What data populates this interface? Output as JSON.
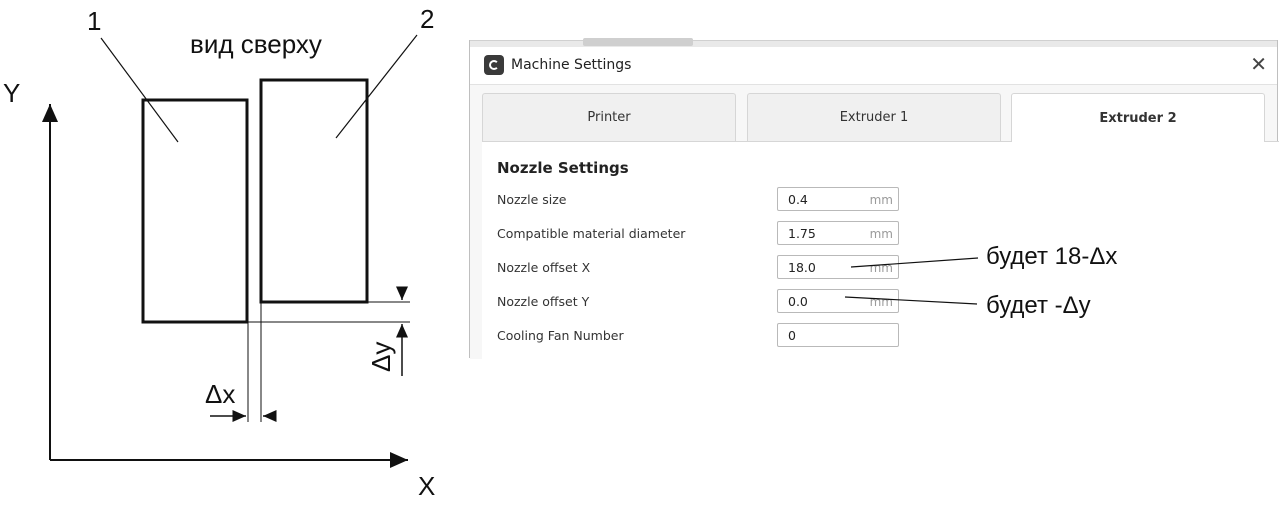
{
  "diagram": {
    "label_1": "1",
    "label_2": "2",
    "view_caption": "вид сверху",
    "axis_y": "Y",
    "axis_x": "X",
    "delta_x": "Δx",
    "delta_y": "Δy"
  },
  "window": {
    "title": "Machine Settings",
    "close_glyph": "✕",
    "tabs": [
      {
        "label": "Printer",
        "active": false
      },
      {
        "label": "Extruder 1",
        "active": false
      },
      {
        "label": "Extruder 2",
        "active": true
      }
    ],
    "section_title": "Nozzle Settings",
    "rows": [
      {
        "label": "Nozzle size",
        "value": "0.4",
        "unit": "mm"
      },
      {
        "label": "Compatible material diameter",
        "value": "1.75",
        "unit": "mm"
      },
      {
        "label": "Nozzle offset X",
        "value": "18.0",
        "unit": "mm"
      },
      {
        "label": "Nozzle offset Y",
        "value": "0.0",
        "unit": "mm"
      },
      {
        "label": "Cooling Fan Number",
        "value": "0",
        "unit": ""
      }
    ]
  },
  "annotations": {
    "offset_x_note": "будет 18-Δx",
    "offset_y_note": "будет -Δy"
  }
}
